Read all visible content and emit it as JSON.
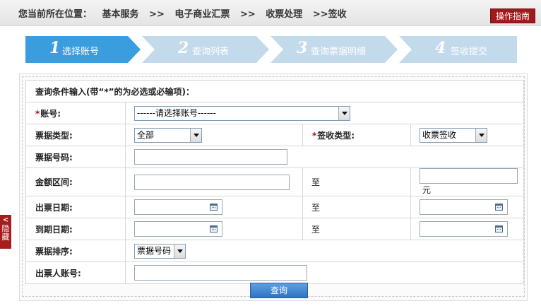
{
  "breadcrumb": {
    "prefix": "您当前所在位置：",
    "items": [
      "基本服务",
      ">>",
      "电子商业汇票",
      ">>",
      "收票处理",
      ">>签收"
    ]
  },
  "guide_button": "操作指南",
  "steps": [
    {
      "num": "1",
      "label": "选择账号",
      "state": "active"
    },
    {
      "num": "2",
      "label": "查询列表",
      "state": "inactive"
    },
    {
      "num": "3",
      "label": "查询票据明细",
      "state": "inactive"
    },
    {
      "num": "4",
      "label": "签收提交",
      "state": "inactive"
    }
  ],
  "form": {
    "header": "查询条件输入(带“*”的为必选或必输项)：",
    "required_mark": "*",
    "account": {
      "label": "账号:",
      "value": "------请选择账号------"
    },
    "bill_type": {
      "label": "票据类型:",
      "value": "全部"
    },
    "sign_type": {
      "label": "签收类型:",
      "value": "收票签收"
    },
    "bill_number": {
      "label": "票据号码:",
      "value": ""
    },
    "amount_range": {
      "label": "金额区间:",
      "to": "至",
      "unit": "元"
    },
    "issue_date": {
      "label": "出票日期:",
      "to": "至"
    },
    "due_date": {
      "label": "到期日期:",
      "to": "至"
    },
    "sort": {
      "label": "票据排序:",
      "value": "票据号码"
    },
    "drawer_account": {
      "label": "出票人账号:",
      "value": ""
    },
    "query_button": "查询"
  },
  "hide_tab": {
    "label_1": "隐",
    "label_2": "藏"
  },
  "colors": {
    "active_step": "#3a9ede",
    "inactive_step": "#c3daeb",
    "guide_button": "#9d1b1b",
    "query_button": "#3d80cf",
    "required": "#d00000"
  }
}
